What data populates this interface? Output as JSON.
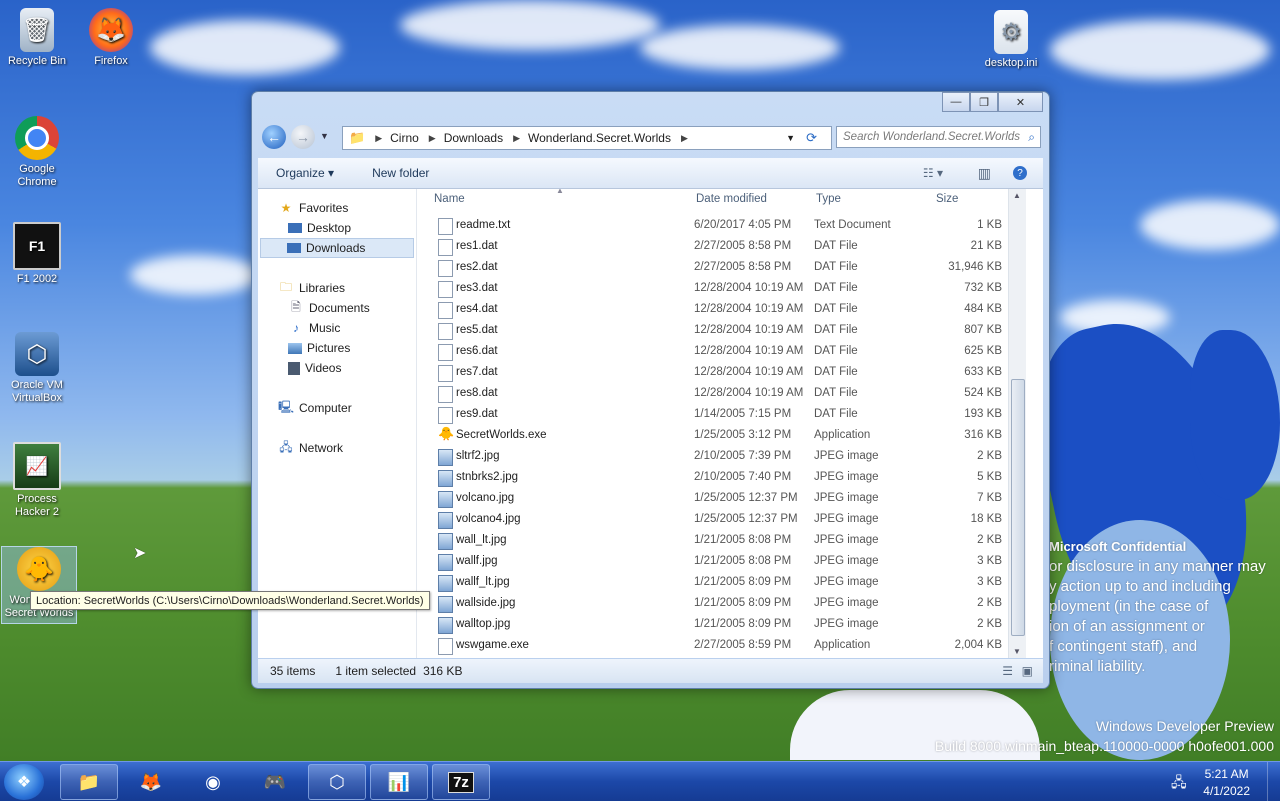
{
  "desktop": {
    "icons": [
      {
        "label": "Recycle Bin"
      },
      {
        "label": "Firefox"
      },
      {
        "label": "Google Chrome"
      },
      {
        "label": "F1 2002"
      },
      {
        "label": "Oracle VM VirtualBox"
      },
      {
        "label": "Process Hacker 2"
      },
      {
        "label": "Wonderland Secret Worlds"
      },
      {
        "label": "desktop.ini"
      }
    ],
    "watermark": {
      "title": "Microsoft Confidential",
      "lines": [
        "or disclosure in any manner may",
        "y action up to and including",
        "ployment (in the case of",
        "ion of an assignment or",
        "f contingent staff), and",
        "riminal liability."
      ],
      "build_line1": "Windows Developer Preview",
      "build_line2": "Build 8000.winmain_bteap.110000-0000 h0ofe001.000"
    }
  },
  "tooltip": "Location: SecretWorlds (C:\\Users\\Cirno\\Downloads\\Wonderland.Secret.Worlds)",
  "explorer": {
    "caption": {
      "minimize": "—",
      "maximize": "❐",
      "close": "✕"
    },
    "breadcrumb": [
      "Cirno",
      "Downloads",
      "Wonderland.Secret.Worlds"
    ],
    "search_placeholder": "Search Wonderland.Secret.Worlds",
    "toolbar": {
      "organize": "Organize ▾",
      "new_folder": "New folder"
    },
    "nav": {
      "favorites": "Favorites",
      "desktop": "Desktop",
      "downloads": "Downloads",
      "libraries": "Libraries",
      "documents": "Documents",
      "music": "Music",
      "pictures": "Pictures",
      "videos": "Videos",
      "computer": "Computer",
      "network": "Network"
    },
    "columns": {
      "name": "Name",
      "date": "Date modified",
      "type": "Type",
      "size": "Size"
    },
    "files": [
      {
        "name": "readme.txt",
        "date": "6/20/2017 4:05 PM",
        "type": "Text Document",
        "size": "1 KB",
        "kind": "doc"
      },
      {
        "name": "res1.dat",
        "date": "2/27/2005 8:58 PM",
        "type": "DAT File",
        "size": "21 KB",
        "kind": "doc"
      },
      {
        "name": "res2.dat",
        "date": "2/27/2005 8:58 PM",
        "type": "DAT File",
        "size": "31,946 KB",
        "kind": "doc"
      },
      {
        "name": "res3.dat",
        "date": "12/28/2004 10:19 AM",
        "type": "DAT File",
        "size": "732 KB",
        "kind": "doc"
      },
      {
        "name": "res4.dat",
        "date": "12/28/2004 10:19 AM",
        "type": "DAT File",
        "size": "484 KB",
        "kind": "doc"
      },
      {
        "name": "res5.dat",
        "date": "12/28/2004 10:19 AM",
        "type": "DAT File",
        "size": "807 KB",
        "kind": "doc"
      },
      {
        "name": "res6.dat",
        "date": "12/28/2004 10:19 AM",
        "type": "DAT File",
        "size": "625 KB",
        "kind": "doc"
      },
      {
        "name": "res7.dat",
        "date": "12/28/2004 10:19 AM",
        "type": "DAT File",
        "size": "633 KB",
        "kind": "doc"
      },
      {
        "name": "res8.dat",
        "date": "12/28/2004 10:19 AM",
        "type": "DAT File",
        "size": "524 KB",
        "kind": "doc"
      },
      {
        "name": "res9.dat",
        "date": "1/14/2005 7:15 PM",
        "type": "DAT File",
        "size": "193 KB",
        "kind": "doc"
      },
      {
        "name": "SecretWorlds.exe",
        "date": "1/25/2005 3:12 PM",
        "type": "Application",
        "size": "316 KB",
        "kind": "exe"
      },
      {
        "name": "sltrf2.jpg",
        "date": "2/10/2005 7:39 PM",
        "type": "JPEG image",
        "size": "2 KB",
        "kind": "img"
      },
      {
        "name": "stnbrks2.jpg",
        "date": "2/10/2005 7:40 PM",
        "type": "JPEG image",
        "size": "5 KB",
        "kind": "img"
      },
      {
        "name": "volcano.jpg",
        "date": "1/25/2005 12:37 PM",
        "type": "JPEG image",
        "size": "7 KB",
        "kind": "img"
      },
      {
        "name": "volcano4.jpg",
        "date": "1/25/2005 12:37 PM",
        "type": "JPEG image",
        "size": "18 KB",
        "kind": "img"
      },
      {
        "name": "wall_lt.jpg",
        "date": "1/21/2005 8:08 PM",
        "type": "JPEG image",
        "size": "2 KB",
        "kind": "img"
      },
      {
        "name": "wallf.jpg",
        "date": "1/21/2005 8:08 PM",
        "type": "JPEG image",
        "size": "3 KB",
        "kind": "img"
      },
      {
        "name": "wallf_lt.jpg",
        "date": "1/21/2005 8:09 PM",
        "type": "JPEG image",
        "size": "3 KB",
        "kind": "img"
      },
      {
        "name": "wallside.jpg",
        "date": "1/21/2005 8:09 PM",
        "type": "JPEG image",
        "size": "2 KB",
        "kind": "img"
      },
      {
        "name": "walltop.jpg",
        "date": "1/21/2005 8:09 PM",
        "type": "JPEG image",
        "size": "2 KB",
        "kind": "img"
      },
      {
        "name": "wswgame.exe",
        "date": "2/27/2005 8:59 PM",
        "type": "Application",
        "size": "2,004 KB",
        "kind": "doc"
      }
    ],
    "status": {
      "count": "35 items",
      "selection": "1 item selected",
      "size": "316 KB"
    }
  },
  "taskbar": {
    "time": "5:21 AM",
    "date": "4/1/2022",
    "start_glyph": "❖",
    "items": [
      {
        "glyph": "📁"
      },
      {
        "glyph": "🦊"
      },
      {
        "glyph": "◉"
      },
      {
        "glyph": "🎮"
      },
      {
        "glyph": "⬡"
      },
      {
        "glyph": "📊"
      },
      {
        "glyph": "7z"
      }
    ],
    "tray_glyph": "🖧"
  },
  "colors": {
    "accent": "#1c48a8",
    "window_frame": "#b9cfee",
    "selection": "#dbe8f7"
  }
}
